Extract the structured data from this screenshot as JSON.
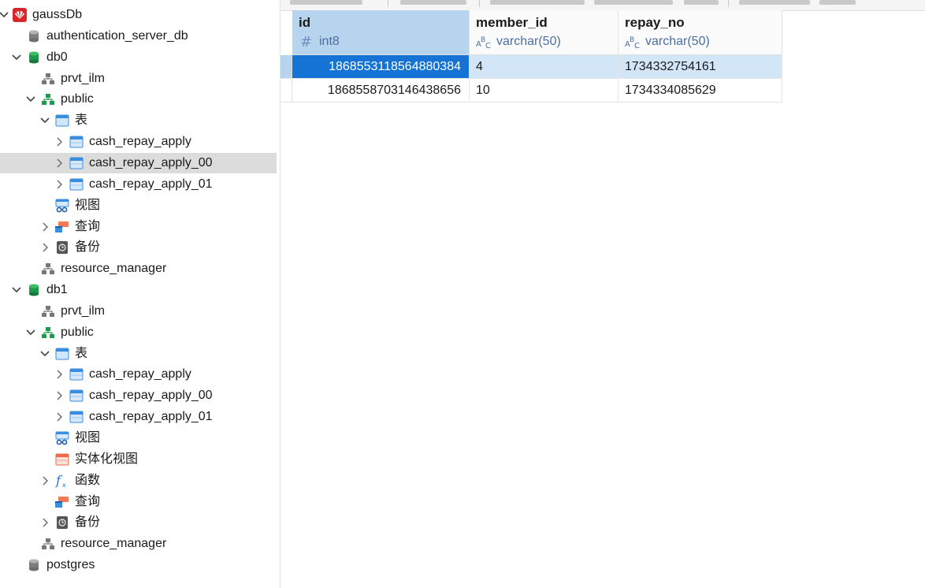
{
  "tree": {
    "nodes": [
      {
        "label": "gaussDb",
        "icon": "huawei-logo-icon",
        "chevron": "down"
      },
      {
        "label": "authentication_server_db",
        "icon": "database-gray-icon",
        "chevron": ""
      },
      {
        "label": "db0",
        "icon": "database-green-icon",
        "chevron": "down"
      },
      {
        "label": "prvt_ilm",
        "icon": "schema-gray-icon",
        "chevron": ""
      },
      {
        "label": "public",
        "icon": "schema-green-icon",
        "chevron": "down"
      },
      {
        "label": "表",
        "icon": "tables-folder-icon",
        "chevron": "down"
      },
      {
        "label": "cash_repay_apply",
        "icon": "table-icon",
        "chevron": "right"
      },
      {
        "label": "cash_repay_apply_00",
        "icon": "table-icon",
        "chevron": "right",
        "selected": true
      },
      {
        "label": "cash_repay_apply_01",
        "icon": "table-icon",
        "chevron": "right"
      },
      {
        "label": "视图",
        "icon": "view-icon",
        "chevron": ""
      },
      {
        "label": "查询",
        "icon": "query-icon",
        "chevron": "right"
      },
      {
        "label": "备份",
        "icon": "backup-icon",
        "chevron": "right"
      },
      {
        "label": "resource_manager",
        "icon": "schema-gray-icon",
        "chevron": ""
      },
      {
        "label": "db1",
        "icon": "database-green-icon",
        "chevron": "down"
      },
      {
        "label": "prvt_ilm",
        "icon": "schema-gray-icon",
        "chevron": ""
      },
      {
        "label": "public",
        "icon": "schema-green-icon",
        "chevron": "down"
      },
      {
        "label": "表",
        "icon": "tables-folder-icon",
        "chevron": "down"
      },
      {
        "label": "cash_repay_apply",
        "icon": "table-icon",
        "chevron": "right"
      },
      {
        "label": "cash_repay_apply_00",
        "icon": "table-icon",
        "chevron": "right"
      },
      {
        "label": "cash_repay_apply_01",
        "icon": "table-icon",
        "chevron": "right"
      },
      {
        "label": "视图",
        "icon": "view-icon",
        "chevron": ""
      },
      {
        "label": "实体化视图",
        "icon": "materialized-view-icon",
        "chevron": ""
      },
      {
        "label": "函数",
        "icon": "function-icon",
        "chevron": "right"
      },
      {
        "label": "查询",
        "icon": "query-icon",
        "chevron": ""
      },
      {
        "label": "备份",
        "icon": "backup-icon",
        "chevron": "right"
      },
      {
        "label": "resource_manager",
        "icon": "schema-gray-icon",
        "chevron": ""
      },
      {
        "label": "postgres",
        "icon": "database-gray-icon",
        "chevron": ""
      }
    ]
  },
  "grid": {
    "columns": [
      {
        "name": "id",
        "type": "int8",
        "type_icon": "hash-icon",
        "selected": true
      },
      {
        "name": "member_id",
        "type": "varchar(50)",
        "type_icon": "text-type-icon"
      },
      {
        "name": "repay_no",
        "type": "varchar(50)",
        "type_icon": "text-type-icon"
      }
    ],
    "rows": [
      {
        "id": "1868553118564880384",
        "member_id": "4",
        "repay_no": "1734332754161",
        "selected": true
      },
      {
        "id": "1868558703146438656",
        "member_id": "10",
        "repay_no": "1734334085629"
      }
    ]
  },
  "colors": {
    "selection_blue": "#1473d4",
    "header_selected": "#b7d4ee",
    "row_selected": "#d3e6f7",
    "tree_selected": "#dcdcdc"
  }
}
